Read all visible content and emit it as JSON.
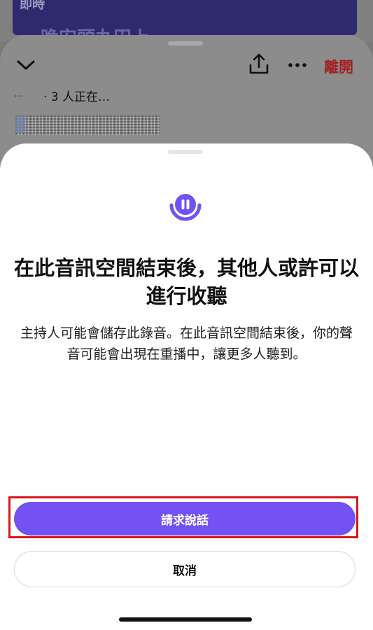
{
  "background": {
    "partial_header_text": "即時",
    "partial_title_text": "晚安頭丸田上"
  },
  "space_panel": {
    "leave_label": "離開",
    "host_dots": "…",
    "listener_status": "· 3 人正在…"
  },
  "dialog": {
    "title": "在此音訊空間結束後，其他人或許可以進行收聽",
    "description": "主持人可能會儲存此錄音。在此音訊空間結束後，你的聲音可能會出現在重播中，讓更多人聽到。",
    "request_button_label": "請求說話",
    "cancel_button_label": "取消"
  },
  "colors": {
    "accent": "#7252f2",
    "leave_red": "#a31f1f",
    "highlight_red": "#d7161d"
  },
  "icons": {
    "collapse": "chevron-down-icon",
    "share": "share-upload-icon",
    "more": "more-dots-icon",
    "spaces": "spaces-mic-icon"
  }
}
